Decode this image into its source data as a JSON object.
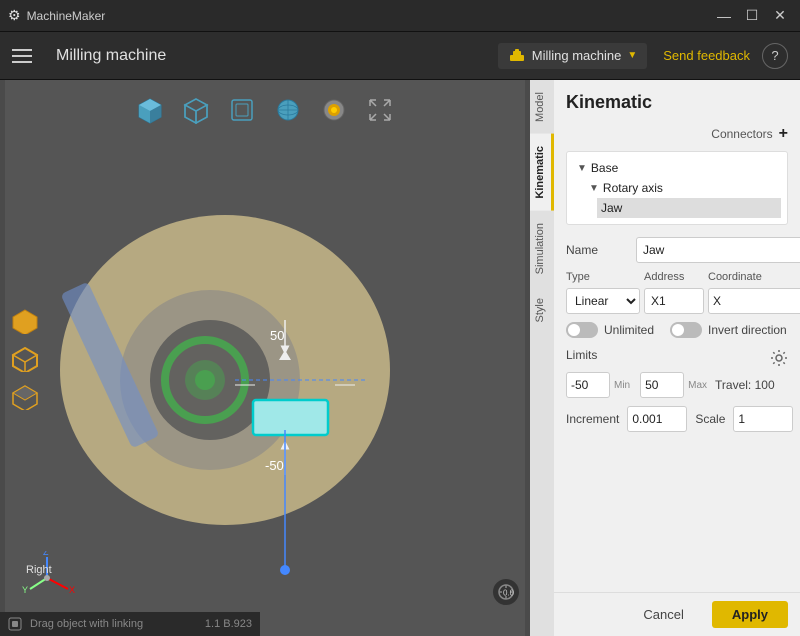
{
  "titlebar": {
    "icon": "⚙",
    "title": "MachineMaker",
    "minimize": "—",
    "maximize": "☐",
    "close": "✕"
  },
  "header": {
    "menu_icon": "☰",
    "title": "Milling machine",
    "machine_label": "Milling machine",
    "send_feedback": "Send feedback",
    "help": "?"
  },
  "vtabs": [
    {
      "label": "Model",
      "id": "model"
    },
    {
      "label": "Kinematic",
      "id": "kinematic",
      "active": true
    },
    {
      "label": "Simulation",
      "id": "simulation"
    },
    {
      "label": "Style",
      "id": "style"
    }
  ],
  "panel": {
    "title": "Kinematic",
    "connectors_label": "Connectors",
    "connectors_add": "+",
    "tree": [
      {
        "label": "Base",
        "level": 0,
        "arrow": "▼"
      },
      {
        "label": "Rotary axis",
        "level": 1,
        "arrow": "▼"
      },
      {
        "label": "Jaw",
        "level": 2,
        "selected": true
      }
    ],
    "name_label": "Name",
    "name_value": "Jaw",
    "name_more": "...",
    "type_label": "Type",
    "address_label": "Address",
    "coordinate_label": "Coordinate",
    "type_value": "Linear",
    "address_value": "X1",
    "coordinate_value": "X",
    "unlimited_label": "Unlimited",
    "invert_label": "Invert direction",
    "limits_label": "Limits",
    "limit_min": "-50",
    "limit_min_label": "Min",
    "limit_max": "50",
    "limit_max_label": "Max",
    "travel_label": "Travel: 100",
    "increment_label": "Increment",
    "increment_value": "0.001",
    "scale_label": "Scale",
    "scale_value": "1"
  },
  "footer": {
    "cancel": "Cancel",
    "apply": "Apply"
  },
  "statusbar": {
    "drag_label": "Drag object with linking",
    "version": "1.1 B.923"
  },
  "toolbar": {
    "icons": [
      "cube-solid",
      "cube-front",
      "cube-back",
      "globe",
      "target",
      "arrows"
    ]
  }
}
